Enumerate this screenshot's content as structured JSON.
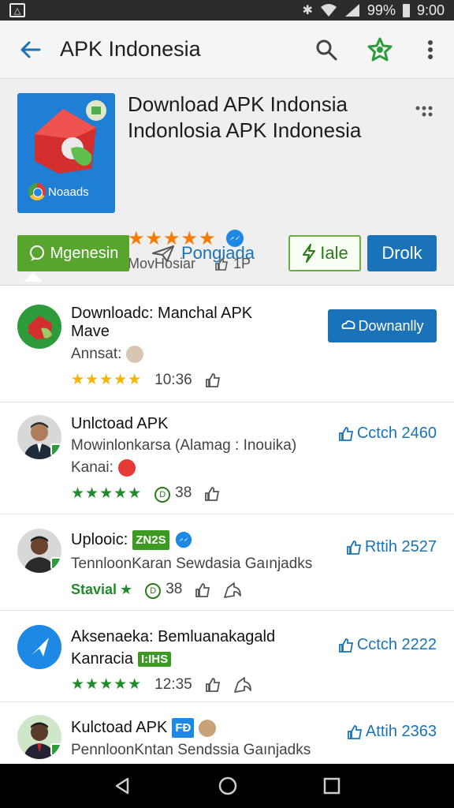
{
  "status_bar": {
    "battery": "99%",
    "time": "9:00"
  },
  "app_bar": {
    "title": "APK Indonesia"
  },
  "header": {
    "title": "Download APK Indonsia Indonlosia APK Indonesia",
    "stars": "★★★★★",
    "meta_left": "MovHosiar",
    "meta_right": "1P",
    "icon_label": "Noaads"
  },
  "chips": {
    "green": "Mgenesin",
    "link": "Pongiada",
    "outline": "Iale",
    "blue": "Drolk"
  },
  "items": [
    {
      "title": "Downloadc: Manchal APK Mave",
      "sub": "Annsat:",
      "stars": "★★★★★",
      "meta": "10:36",
      "button": "Downanlly"
    },
    {
      "title": "Unlctoad APK",
      "sub": "Mowinlonkarsa (Alamag : Inouika)",
      "sub2": "Kanai:",
      "stars": "★★★★★",
      "count": "38",
      "action": "Cctch 2460"
    },
    {
      "title": "Uplooic:",
      "tag": "ZN2S",
      "sub": "TennloonKaran Sewdasia Gaınjadks",
      "status": "Stavial",
      "count": "38",
      "action": "Rttih 2527"
    },
    {
      "title": "Aksenaeka: Bemluanakagald",
      "sub": "Kanracia",
      "tag": "I:IHS",
      "stars": "★★★★★",
      "meta": "12:35",
      "action": "Cctch 2222"
    },
    {
      "title": "Kulctoad APK",
      "tag": "FÐ",
      "sub": "PennloonKntan Sendssia Gaınjadks",
      "action": "Attih 2363"
    }
  ]
}
